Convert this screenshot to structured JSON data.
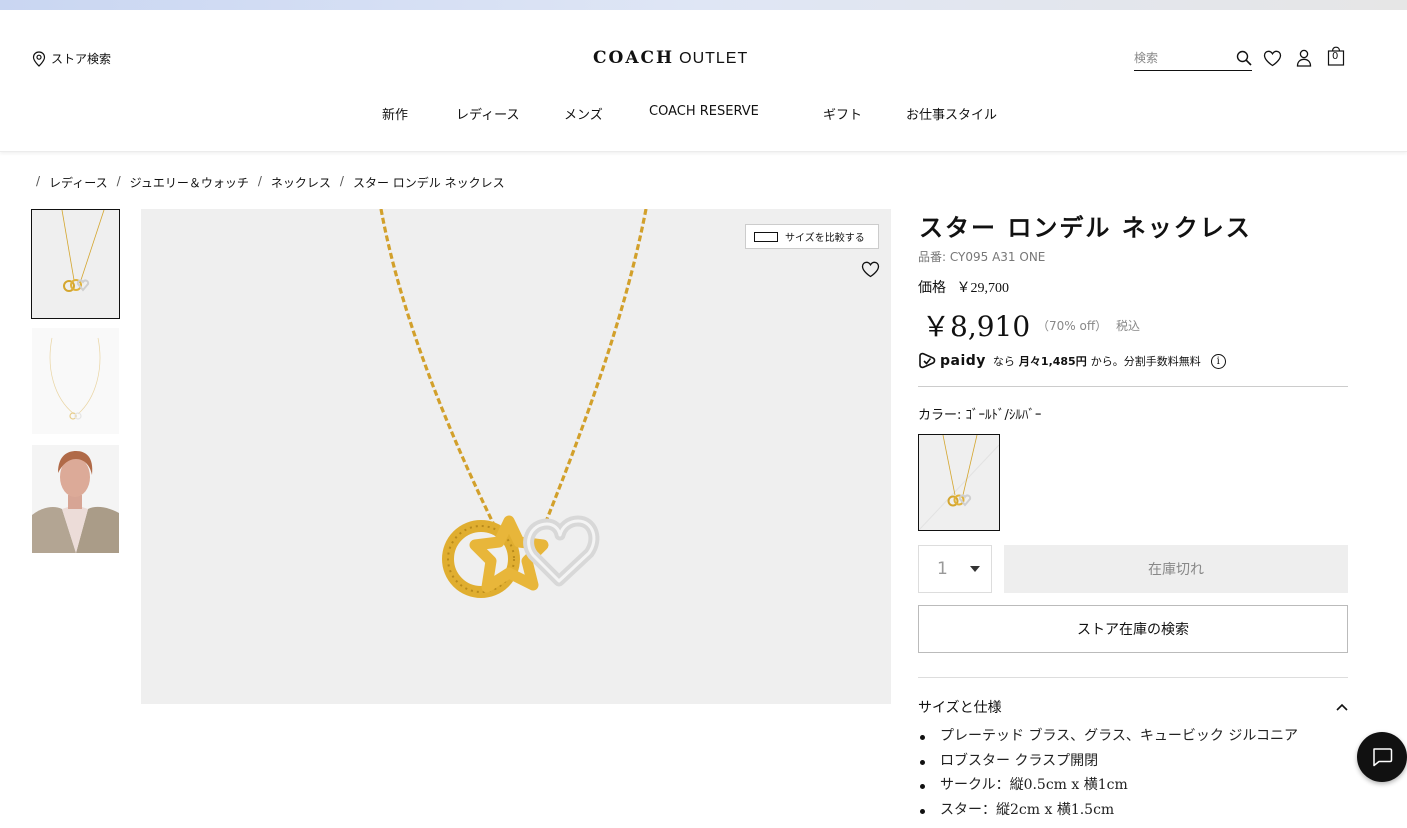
{
  "header": {
    "store_search": "ストア検索",
    "logo_brand": "COACH",
    "logo_sub": "OUTLET",
    "search_placeholder": "検索",
    "cart_count": "0"
  },
  "nav": [
    "新作",
    "レディース",
    "メンズ",
    "COACH RESERVE",
    "ギフト",
    "お仕事スタイル"
  ],
  "breadcrumb": [
    "レディース",
    "ジュエリー＆ウォッチ",
    "ネックレス",
    "スター ロンデル ネックレス"
  ],
  "gallery": {
    "compare_label": "サイズを比較する"
  },
  "product": {
    "title": "スター ロンデル ネックレス",
    "sku": "品番: CY095 A31 ONE",
    "original_label": "価格",
    "original_price": "￥29,700",
    "sale_price": "￥8,910",
    "discount": "（70% off）",
    "tax": "税込",
    "paidy_brand": "paidy",
    "paidy_pre": "なら",
    "paidy_amount": "月々1,485円",
    "paidy_post": "から。分割手数料無料",
    "color_label": "カラー: ｺﾞｰﾙﾄﾞ/ｼﾙﾊﾞｰ",
    "quantity": "1",
    "sold_out": "在庫切れ",
    "store_stock": "ストア在庫の検索",
    "spec_heading": "サイズと仕様",
    "specs": [
      "プレーテッド ブラス、グラス、キュービック ジルコニア",
      "ロブスター クラスプ開閉",
      "サークル：縦0.5cm x 横1cm",
      "スター：縦2cm x 横1.5cm"
    ]
  },
  "colors": {
    "gold": "#d9a82c",
    "silver": "#d6d6d6",
    "image_bg": "#efefef",
    "soldout_bg": "#eeeeee"
  }
}
